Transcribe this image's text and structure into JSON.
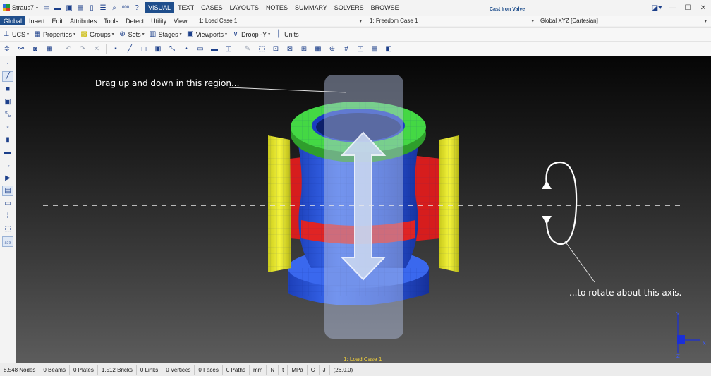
{
  "app": {
    "name": "Straus7",
    "document_title": "Cast Iron Valve",
    "ribbon_tabs": [
      "VISUAL",
      "TEXT",
      "CASES",
      "LAYOUTS",
      "NOTES",
      "SUMMARY",
      "SOLVERS",
      "BROWSE"
    ],
    "active_tab": "VISUAL",
    "qa_icons": [
      "new-file-icon",
      "open-folder-icon",
      "save-icon",
      "save-all-icon",
      "page-icon",
      "report-icon",
      "search-icon",
      "number-icon",
      "help-icon"
    ],
    "qa_number_label": "000",
    "help_label": "?"
  },
  "menu": {
    "items": [
      "Global",
      "Insert",
      "Edit",
      "Attributes",
      "Tools",
      "Detect",
      "Utility",
      "View"
    ],
    "active": "Global",
    "load_case": "1: Load Case 1",
    "freedom_case": "1: Freedom Case 1",
    "coord_system": "Global XYZ [Cartesian]"
  },
  "toolbar1": {
    "items": [
      {
        "label": "UCS",
        "icon": "ucs-icon"
      },
      {
        "label": "Properties",
        "icon": "properties-icon"
      },
      {
        "label": "Groups",
        "icon": "groups-icon"
      },
      {
        "label": "Sets",
        "icon": "sets-icon"
      },
      {
        "label": "Stages",
        "icon": "stages-icon"
      },
      {
        "label": "Viewports",
        "icon": "viewports-icon"
      },
      {
        "label": "Droop -Y",
        "icon": "droop-icon"
      },
      {
        "label": "Units",
        "icon": "units-icon"
      }
    ]
  },
  "toolbar2": {
    "icons": [
      "settings-icon",
      "binoculars-icon",
      "camera-icon",
      "grid-icon",
      "undo-icon",
      "redo-icon",
      "delete-icon",
      "node-icon",
      "beam-icon",
      "plate-icon",
      "brick-icon",
      "link-icon",
      "vertex-icon",
      "face-icon",
      "path-icon",
      "load-icon",
      "pencil-icon",
      "select-box-icon",
      "select-node-icon",
      "select-element-icon",
      "select-all-icon",
      "property-select-icon",
      "group-select-icon",
      "hash-icon",
      "entity-filter-icon",
      "table-icon",
      "layout-icon"
    ]
  },
  "palette": {
    "icons": [
      "point-icon",
      "line-icon",
      "square-icon",
      "cube-icon",
      "link-tool-icon",
      "node-tool-icon",
      "cylinder-icon",
      "ruler-icon",
      "arrow-right-icon",
      "extrude-icon",
      "selection-icon",
      "monitor-icon",
      "grid-dots-icon",
      "dashed-box-icon",
      "subscript-icon"
    ]
  },
  "viewport": {
    "drag_hint": "Drag up and down in this region...",
    "rotate_hint": "...to rotate about this axis.",
    "case_caption": "1: Load Case 1",
    "axis_labels": {
      "y": "Y",
      "x": "X",
      "z": "Z"
    },
    "colors": {
      "body": "#2f5fe8",
      "top_flange": "#38d83a",
      "side_flanges": "#e4e430",
      "red_bands": "#e02020",
      "drag_region": "#9fb0d0",
      "case_caption": "#f5d33a"
    }
  },
  "status": {
    "nodes": "8,548 Nodes",
    "beams": "0 Beams",
    "plates": "0 Plates",
    "bricks": "1,512 Bricks",
    "links": "0 Links",
    "vertices": "0 Vertices",
    "faces": "0 Faces",
    "paths": "0 Paths",
    "length_unit": "mm",
    "force_unit": "N",
    "temp_unit": "t",
    "stress_unit": "MPa",
    "energy_unit": "C",
    "extra_unit": "J",
    "coords": "(26,0,0)"
  }
}
